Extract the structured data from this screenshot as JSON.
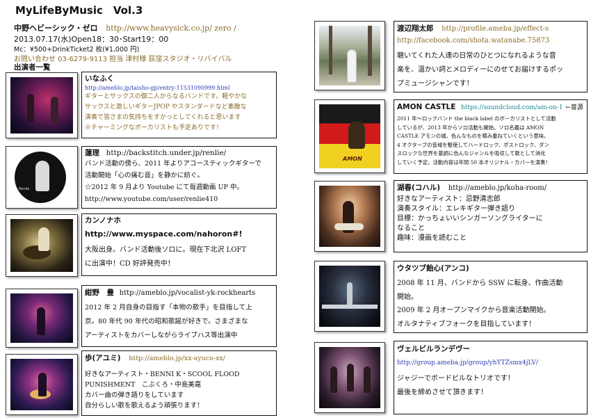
{
  "header": {
    "title": "MyLifeByMusic　Vol.3",
    "venue": "中野ヘビーシック・ゼロ",
    "venue_url": "http://www.heavysick.co.jp/ zero /",
    "date_line": "2013.07.17(水)Open18：30･Start19：00",
    "price_line": "Mc：¥500+DrinkTicket2 枚(¥1,000 円)",
    "contact_line": "お問い合わせ 03-6279-9113 担当 津村様 荻窪スタジオ・リバイバル",
    "performers_heading": "出演者一覧"
  },
  "performers": [
    {
      "name": "いなふく",
      "url": "http://ameblo.jp/taisho-gp/entry-11531090999.html",
      "lines": [
        "ギターとサックスの御二人からなるバンドです。軽やかな",
        "サックスと激しいギターJPOP やスタンダードなど素敵な",
        "演奏で皆さまの気持ちをすかっとしてくれると思います",
        "※チャーミングなボーカリストも予定ありです！"
      ]
    },
    {
      "name": "蓮理",
      "url": "http://backstitch.under.jp/renlie/",
      "lines": [
        "バンド活動の傍ら、2011 年よりアコースティックギターで",
        "活動開始「心の痛む音」を静かに紡ぐ。",
        "☆2012 年 9 月より Youtube にて毎週動画 UP 中。",
        "http://www.youtube.com/user/renlie410"
      ],
      "photo_caption": "Renlie"
    },
    {
      "name": "カンノナホ",
      "url": "http://www.myspace.com/nahoron#!",
      "lines": [
        "大阪出身。バンド活動後ソロに。現在下北沢 LOFT",
        "に出演中！CD 好評発売中！"
      ]
    },
    {
      "name": "紺野　豊",
      "url": "http://ameblo.jp/vocalist-yk-rockhearts",
      "lines": [
        "2012 年 2 月自身の目指す「本物の歌手」を目指して上",
        "京。80 年代 90 年代の昭和歌謡が好きで。さまざまな",
        "アーティストをカバーしながらライブハス等出演中"
      ]
    },
    {
      "name": "歩(アユミ)",
      "url": "http://ameblo.jp/xx-ayuco-xx/",
      "lines": [
        "好きなアーティスト・BENNI K・SCOOL FLOOD",
        "PUNISHMENT　こぶくろ・中島美嘉",
        "カバー曲の弾き語りをしています",
        "自分らしい歌を歌えるよう頑張ります！"
      ]
    },
    {
      "name": "渡辺翔太郎",
      "url": "http://profile.ameba.jp/effect-s",
      "url2": "http://facebook.com/shota.watanabe.75873",
      "lines": [
        "聴いてくれた人達の日常のひとつになれるような音",
        "楽を、温かい詞とメロディーにのせてお届けするポッ",
        "プミュージシャンです！"
      ]
    },
    {
      "name": "AMON CASTLE",
      "url": "https://soundcloud.com/am-on-1",
      "url_suffix": "←音源",
      "lines": [
        "2011 年～ロックバンド the black label のボーカリストとして活動",
        "しているが、2013 年からソロ活動も開始。ソロ名義は AMON",
        "CASTLE アモンの城、色んなものを積み重ねていくという意味。",
        "4 オクターブの音域を駆使してハードロック、ポストロック、ダン",
        "スロックな世界を基調に色んなジャンルを吸収して歌として消化",
        "していく予定。活動内容は年間 50 本オリジナル・カバーを演奏！"
      ],
      "photo_caption": "AMON"
    },
    {
      "name": "湖春(コハル)",
      "url": "http://ameblo.jp/koha-room/",
      "lines": [
        "好きなアーティスト：忌野清志郎",
        "演奏スタイル：エレキギター弾き語り",
        "目標：かっちょいいシンガーソングライターに",
        "なること",
        "趣味：漫画を読むこと"
      ]
    },
    {
      "name": "ウタツブ飴心(アンコ)",
      "lines": [
        "2008 年 11 月、バンドから SSW に転身、作曲活動",
        "開始。",
        "2009 年 2 月オープンマイクから音楽活動開始。",
        "オルタナティブフォークを目指しています！"
      ]
    },
    {
      "name": "ヴェルビルランデヴー",
      "url": "http://group.ameba.jp/group/yhYTZsmx4jLV/",
      "lines": [
        "ジャジーでボードビルなトリオです！",
        "最後を締めさせて頂きます！"
      ]
    }
  ],
  "colors": {
    "gold": "#8b6b2a",
    "blue": "#2a3db4",
    "teal": "#1f8a9a"
  }
}
